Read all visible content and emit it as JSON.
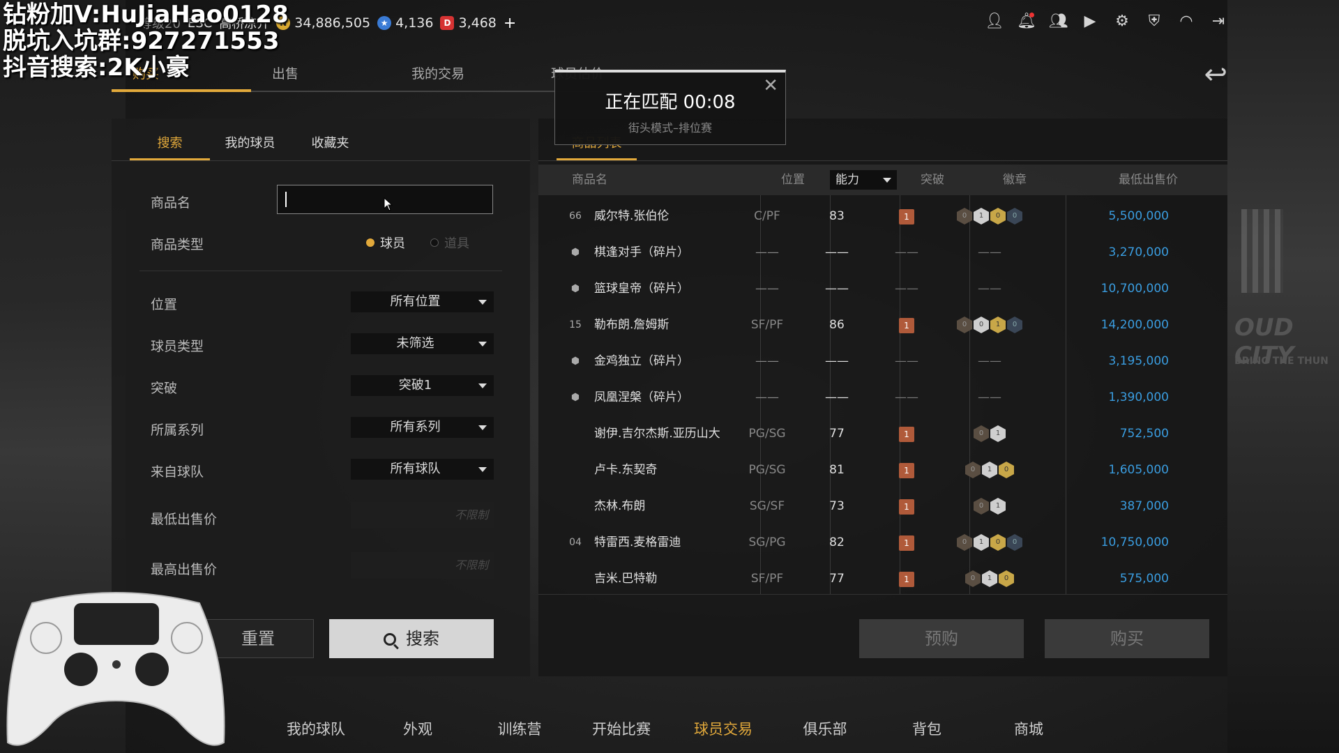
{
  "watermark": {
    "line1": "钻粉加V:HuJiaHao0128",
    "line2": "脱坑入坑群:927271553",
    "line3": "抖音搜索:2K小豪"
  },
  "top": {
    "level": "等级20",
    "team": "ESC",
    "username": "高桥凉介",
    "currencies": [
      {
        "icon": "vc-coin-icon",
        "value": "34,886,505"
      },
      {
        "icon": "star-icon",
        "value": "4,136"
      },
      {
        "icon": "ticket-icon",
        "value": "3,468"
      }
    ],
    "plus": "+"
  },
  "main_tabs": [
    "购买",
    "出售",
    "我的交易",
    "球员估价"
  ],
  "left": {
    "sub_tabs": [
      "搜索",
      "我的球员",
      "收藏夹"
    ],
    "fields": {
      "name_label": "商品名",
      "name_value": "",
      "type_label": "商品类型",
      "type_options": [
        "球员",
        "道具"
      ],
      "position_label": "位置",
      "position_value": "所有位置",
      "player_type_label": "球员类型",
      "player_type_value": "未筛选",
      "breakthrough_label": "突破",
      "breakthrough_value": "突破1",
      "series_label": "所属系列",
      "series_value": "所有系列",
      "team_label": "来自球队",
      "team_value": "所有球队",
      "min_price_label": "最低出售价",
      "min_price_placeholder": "不限制",
      "max_price_label": "最高出售价",
      "max_price_placeholder": "不限制"
    },
    "reset": "重置",
    "search": "搜索"
  },
  "right": {
    "tab": "商品列表",
    "headers": {
      "name": "商品名",
      "position": "位置",
      "sort": "能力",
      "breakthrough": "突破",
      "badges": "徽章",
      "price": "最低出售价"
    },
    "rows": [
      {
        "num": "66",
        "name": "威尔特.张伯伦",
        "pos": "C/PF",
        "ovr": "83",
        "brk": "1",
        "badges": [
          "0",
          "1",
          "0",
          "0"
        ],
        "price": "5,500,000"
      },
      {
        "num": "",
        "name": "棋逢对手（碎片）",
        "pos": "——",
        "ovr": "——",
        "brk": "——",
        "badges": "——",
        "price": "3,270,000"
      },
      {
        "num": "",
        "name": "篮球皇帝（碎片）",
        "pos": "——",
        "ovr": "——",
        "brk": "——",
        "badges": "——",
        "price": "10,700,000"
      },
      {
        "num": "15",
        "name": "勒布朗.詹姆斯",
        "pos": "SF/PF",
        "ovr": "86",
        "brk": "1",
        "badges": [
          "0",
          "0",
          "1",
          "0"
        ],
        "price": "14,200,000"
      },
      {
        "num": "",
        "name": "金鸡独立（碎片）",
        "pos": "——",
        "ovr": "——",
        "brk": "——",
        "badges": "——",
        "price": "3,195,000"
      },
      {
        "num": "",
        "name": "凤凰涅槃（碎片）",
        "pos": "——",
        "ovr": "——",
        "brk": "——",
        "badges": "——",
        "price": "1,390,000"
      },
      {
        "num": "",
        "name": "谢伊.吉尔杰斯.亚历山大",
        "pos": "PG/SG",
        "ovr": "77",
        "brk": "1",
        "badges": [
          "0",
          "1"
        ],
        "price": "752,500"
      },
      {
        "num": "",
        "name": "卢卡.东契奇",
        "pos": "PG/SG",
        "ovr": "81",
        "brk": "1",
        "badges": [
          "0",
          "1",
          "0"
        ],
        "price": "1,605,000"
      },
      {
        "num": "",
        "name": "杰林.布朗",
        "pos": "SG/SF",
        "ovr": "73",
        "brk": "1",
        "badges": [
          "0",
          "1"
        ],
        "price": "387,000"
      },
      {
        "num": "04",
        "name": "特雷西.麦格雷迪",
        "pos": "SG/PG",
        "ovr": "82",
        "brk": "1",
        "badges": [
          "0",
          "1",
          "0",
          "0"
        ],
        "price": "10,750,000"
      },
      {
        "num": "",
        "name": "吉米.巴特勒",
        "pos": "SF/PF",
        "ovr": "77",
        "brk": "1",
        "badges": [
          "0",
          "1",
          "0"
        ],
        "price": "575,000"
      }
    ],
    "preorder": "预购",
    "buy": "购买"
  },
  "popup": {
    "title": "正在匹配 00:08",
    "subtitle": "街头模式–排位赛"
  },
  "bottom_nav": [
    "我的球队",
    "外观",
    "训练营",
    "开始比赛",
    "球员交易",
    "俱乐部",
    "背包",
    "商城"
  ],
  "colors": {
    "accent": "#e2a93b",
    "price": "#3a9de0"
  }
}
